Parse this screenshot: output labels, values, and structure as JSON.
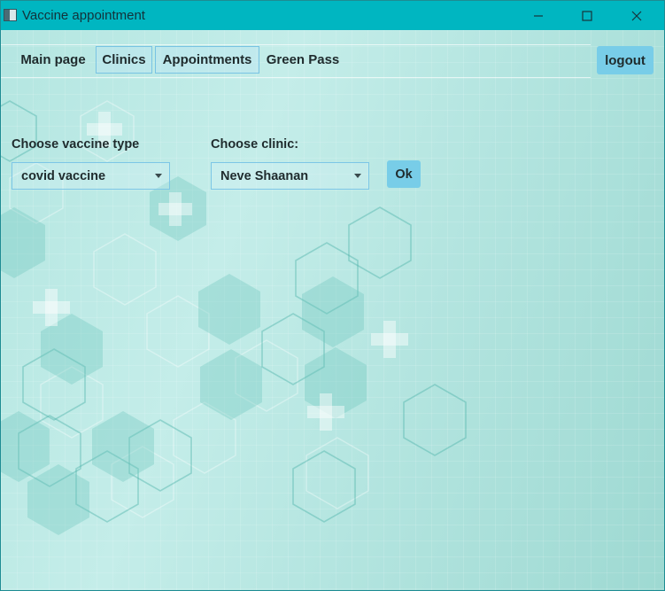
{
  "window": {
    "title": "Vaccine appointment",
    "icon": "app-window-icon",
    "controls": {
      "minimize_icon": "minimize-icon",
      "maximize_icon": "maximize-icon",
      "close_icon": "close-icon"
    }
  },
  "nav": {
    "items": [
      {
        "label": "Main page"
      },
      {
        "label": "Clinics"
      },
      {
        "label": "Appointments"
      },
      {
        "label": "Green Pass"
      }
    ],
    "logout_label": "logout"
  },
  "form": {
    "vaccine_label": "Choose vaccine type",
    "vaccine_selected": "covid vaccine",
    "clinic_label": "Choose clinic:",
    "clinic_selected": "Neve Shaanan",
    "ok_label": "Ok"
  },
  "colors": {
    "titlebar": "#00b6c1",
    "button": "#78cde8",
    "background": "#b4e6e1"
  }
}
